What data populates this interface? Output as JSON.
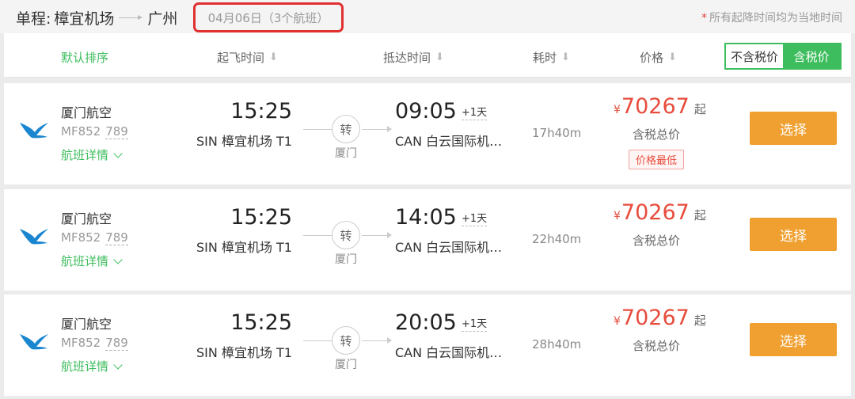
{
  "header": {
    "trip_type": "单程:",
    "origin": "樟宜机场",
    "destination": "广州",
    "date_summary": "04月06日（3个航班）",
    "timezone_note_star": "*",
    "timezone_note": "所有起降时间均为当地时间"
  },
  "sortbar": {
    "default_sort": "默认排序",
    "departure": "起飞时间",
    "arrival": "抵达时间",
    "duration": "耗时",
    "price": "价格",
    "sort_arrow": "⬇",
    "tax_excluded": "不含税价",
    "tax_included": "含税价"
  },
  "flights": [
    {
      "airline": "厦门航空",
      "flight_no": "MF852",
      "aircraft": "789",
      "details": "航班详情",
      "dep_time": "15:25",
      "dep_airport": "SIN 樟宜机场 T1",
      "transfer": "转",
      "via": "厦门",
      "arr_time": "09:05",
      "plus_day": "+1天",
      "arr_airport": "CAN 白云国际机…",
      "duration": "17h40m",
      "currency": "¥",
      "price": "70267",
      "price_from": "起",
      "price_note": "含税总价",
      "badge": "价格最低",
      "select": "选择"
    },
    {
      "airline": "厦门航空",
      "flight_no": "MF852",
      "aircraft": "789",
      "details": "航班详情",
      "dep_time": "15:25",
      "dep_airport": "SIN 樟宜机场 T1",
      "transfer": "转",
      "via": "厦门",
      "arr_time": "14:05",
      "plus_day": "+1天",
      "arr_airport": "CAN 白云国际机…",
      "duration": "22h40m",
      "currency": "¥",
      "price": "70267",
      "price_from": "起",
      "price_note": "含税总价",
      "select": "选择"
    },
    {
      "airline": "厦门航空",
      "flight_no": "MF852",
      "aircraft": "789",
      "details": "航班详情",
      "dep_time": "15:25",
      "dep_airport": "SIN 樟宜机场 T1",
      "transfer": "转",
      "via": "厦门",
      "arr_time": "20:05",
      "plus_day": "+1天",
      "arr_airport": "CAN 白云国际机…",
      "duration": "28h40m",
      "currency": "¥",
      "price": "70267",
      "price_from": "起",
      "price_note": "含税总价",
      "select": "选择"
    }
  ],
  "colors": {
    "accent_green": "#3dbd5d",
    "price_red": "#e74c3c",
    "button_orange": "#f0a030",
    "highlight_red": "#e03030",
    "logo_blue": "#1a86d0"
  },
  "icons": {
    "airline_logo": "xiamen-airlines-egret-icon",
    "sort": "down-arrow-icon",
    "details": "chevron-down-icon"
  }
}
